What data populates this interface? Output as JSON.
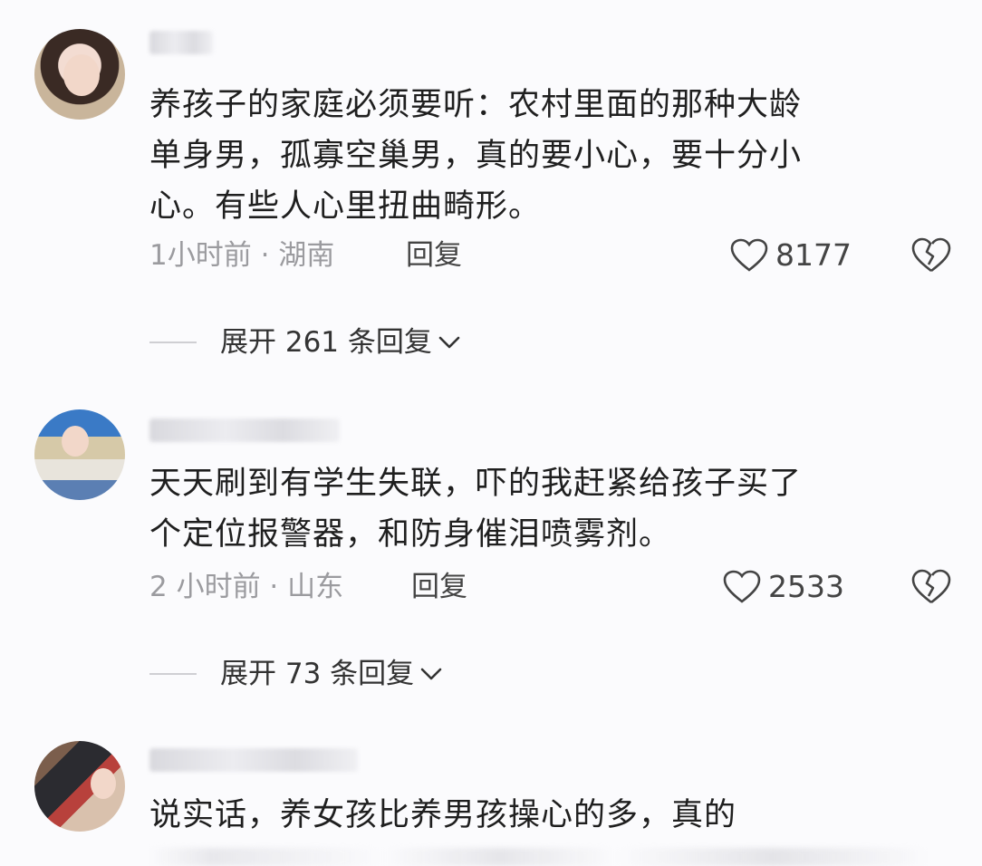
{
  "comments": [
    {
      "text": "养孩子的家庭必须要听：农村里面的那种大龄\n单身男，孤寡空巢男，真的要小心，要十分小\n心。有些人心里扭曲畸形。",
      "meta": "1小时前 · 湖南",
      "reply_label": "回复",
      "likes": "8177",
      "expand_label": "展开 261 条回复"
    },
    {
      "text": "天天刷到有学生失联，吓的我赶紧给孩子买了\n个定位报警器，和防身催泪喷雾剂。",
      "meta": "2 小时前 · 山东",
      "reply_label": "回复",
      "likes": "2533",
      "expand_label": "展开 73 条回复"
    },
    {
      "text": "说实话，养女孩比养男孩操心的多，真的"
    }
  ],
  "icons": {
    "like": "heart-outline-icon",
    "dislike": "broken-heart-icon",
    "expand": "chevron-down-icon"
  }
}
